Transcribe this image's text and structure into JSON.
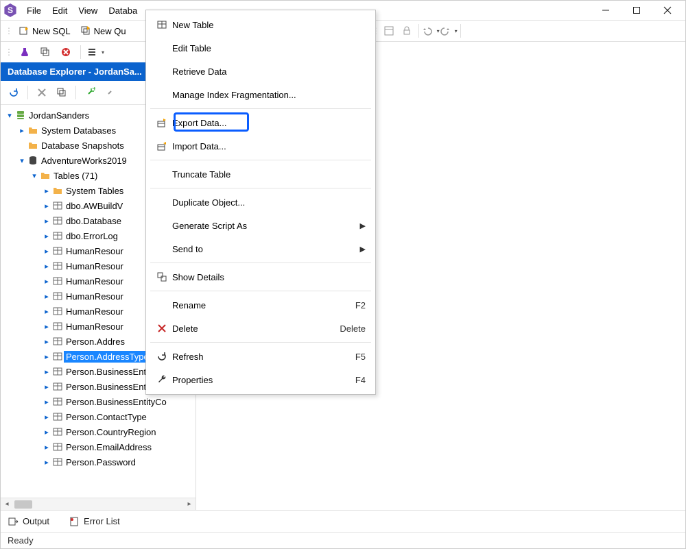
{
  "menubar": [
    "File",
    "Edit",
    "View",
    "Databa"
  ],
  "toolbar": {
    "newSql": "New SQL",
    "newQu": "New Qu"
  },
  "sidebar": {
    "title": "Database Explorer - JordanSa...",
    "root": "JordanSanders",
    "sysdb": "System Databases",
    "snap": "Database Snapshots",
    "adv": "AdventureWorks2019",
    "tables": "Tables (71)",
    "systables": "System Tables",
    "rows": [
      "dbo.AWBuildV",
      "dbo.Database",
      "dbo.ErrorLog",
      "HumanResour",
      "HumanResour",
      "HumanResour",
      "HumanResour",
      "HumanResour",
      "HumanResour",
      "Person.Addres"
    ],
    "selected": "Person.AddressType",
    "rows2": [
      "Person.BusinessEntity",
      "Person.BusinessEntityAd",
      "Person.BusinessEntityCo",
      "Person.ContactType",
      "Person.CountryRegion",
      "Person.EmailAddress",
      "Person.Password"
    ]
  },
  "context_menu": {
    "items": [
      {
        "label": "New Table",
        "icon": "table"
      },
      {
        "label": "Edit Table"
      },
      {
        "label": "Retrieve Data"
      },
      {
        "label": "Manage Index Fragmentation..."
      },
      {
        "sep": true
      },
      {
        "label": "Export Data...",
        "icon": "export",
        "highlight": true
      },
      {
        "label": "Import Data...",
        "icon": "import"
      },
      {
        "sep": true
      },
      {
        "label": "Truncate Table"
      },
      {
        "sep": true
      },
      {
        "label": "Duplicate Object..."
      },
      {
        "label": "Generate Script As",
        "sub": true
      },
      {
        "label": "Send to",
        "sub": true
      },
      {
        "sep": true
      },
      {
        "label": "Show Details",
        "icon": "details"
      },
      {
        "sep": true
      },
      {
        "label": "Rename",
        "shortcut": "F2"
      },
      {
        "label": "Delete",
        "shortcut": "Delete",
        "icon": "delete"
      },
      {
        "sep": true
      },
      {
        "label": "Refresh",
        "shortcut": "F5",
        "icon": "refresh"
      },
      {
        "label": "Properties",
        "shortcut": "F4",
        "icon": "wrench"
      }
    ]
  },
  "bottom_tabs": {
    "output": "Output",
    "errors": "Error List"
  },
  "status": "Ready"
}
